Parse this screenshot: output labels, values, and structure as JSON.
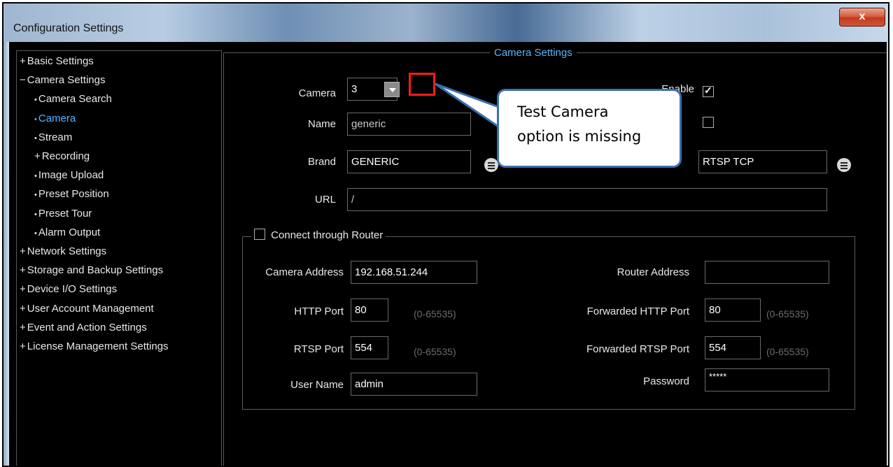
{
  "window": {
    "title": "Configuration Settings",
    "close_label": "x"
  },
  "tree": {
    "items": [
      {
        "label": "Basic Settings",
        "prefix": "+",
        "level": 0,
        "selected": false
      },
      {
        "label": "Camera Settings",
        "prefix": "−",
        "level": 0,
        "selected": false
      },
      {
        "label": "Camera Search",
        "prefix": "•",
        "level": 1,
        "selected": false
      },
      {
        "label": "Camera",
        "prefix": "•",
        "level": 1,
        "selected": true
      },
      {
        "label": "Stream",
        "prefix": "•",
        "level": 1,
        "selected": false
      },
      {
        "label": "Recording",
        "prefix": "+",
        "level": 1,
        "selected": false
      },
      {
        "label": "Image Upload",
        "prefix": "•",
        "level": 1,
        "selected": false
      },
      {
        "label": "Preset Position",
        "prefix": "•",
        "level": 1,
        "selected": false
      },
      {
        "label": "Preset Tour",
        "prefix": "•",
        "level": 1,
        "selected": false
      },
      {
        "label": "Alarm Output",
        "prefix": "•",
        "level": 1,
        "selected": false
      },
      {
        "label": "Network Settings",
        "prefix": "+",
        "level": 0,
        "selected": false
      },
      {
        "label": "Storage and Backup Settings",
        "prefix": "+",
        "level": 0,
        "selected": false
      },
      {
        "label": "Device I/O Settings",
        "prefix": "+",
        "level": 0,
        "selected": false
      },
      {
        "label": "User Account Management",
        "prefix": "+",
        "level": 0,
        "selected": false
      },
      {
        "label": "Event and Action Settings",
        "prefix": "+",
        "level": 0,
        "selected": false
      },
      {
        "label": "License Management Settings",
        "prefix": "+",
        "level": 0,
        "selected": false
      }
    ]
  },
  "camera_settings": {
    "legend": "Camera Settings",
    "camera_label": "Camera",
    "camera_value": "3",
    "enable_label": "Enable",
    "enable_checked": true,
    "name_label": "Name",
    "name_value": "generic",
    "brand_label": "Brand",
    "brand_value": "GENERIC",
    "protocol_value": "RTSP TCP",
    "url_label": "URL",
    "url_value": "/"
  },
  "router": {
    "legend": "Connect through Router",
    "camera_address_label": "Camera Address",
    "camera_address_value": "192.168.51.244",
    "router_address_label": "Router Address",
    "router_address_value": "",
    "http_port_label": "HTTP Port",
    "http_port_value": "80",
    "http_range": "(0-65535)",
    "forwarded_http_label": "Forwarded HTTP Port",
    "forwarded_http_value": "80",
    "forwarded_http_range": "(0-65535)",
    "rtsp_port_label": "RTSP Port",
    "rtsp_port_value": "554",
    "rtsp_range": "(0-65535)",
    "forwarded_rtsp_label": "Forwarded RTSP Port",
    "forwarded_rtsp_value": "554",
    "forwarded_rtsp_range": "(0-65535)",
    "user_name_label": "User Name",
    "user_name_value": "admin",
    "password_label": "Password",
    "password_value": "*****"
  },
  "annotation": {
    "line1": "Test Camera",
    "line2": "option is missing",
    "highlight_color": "#ff1b1b",
    "callout_border": "#3a6fb0"
  }
}
